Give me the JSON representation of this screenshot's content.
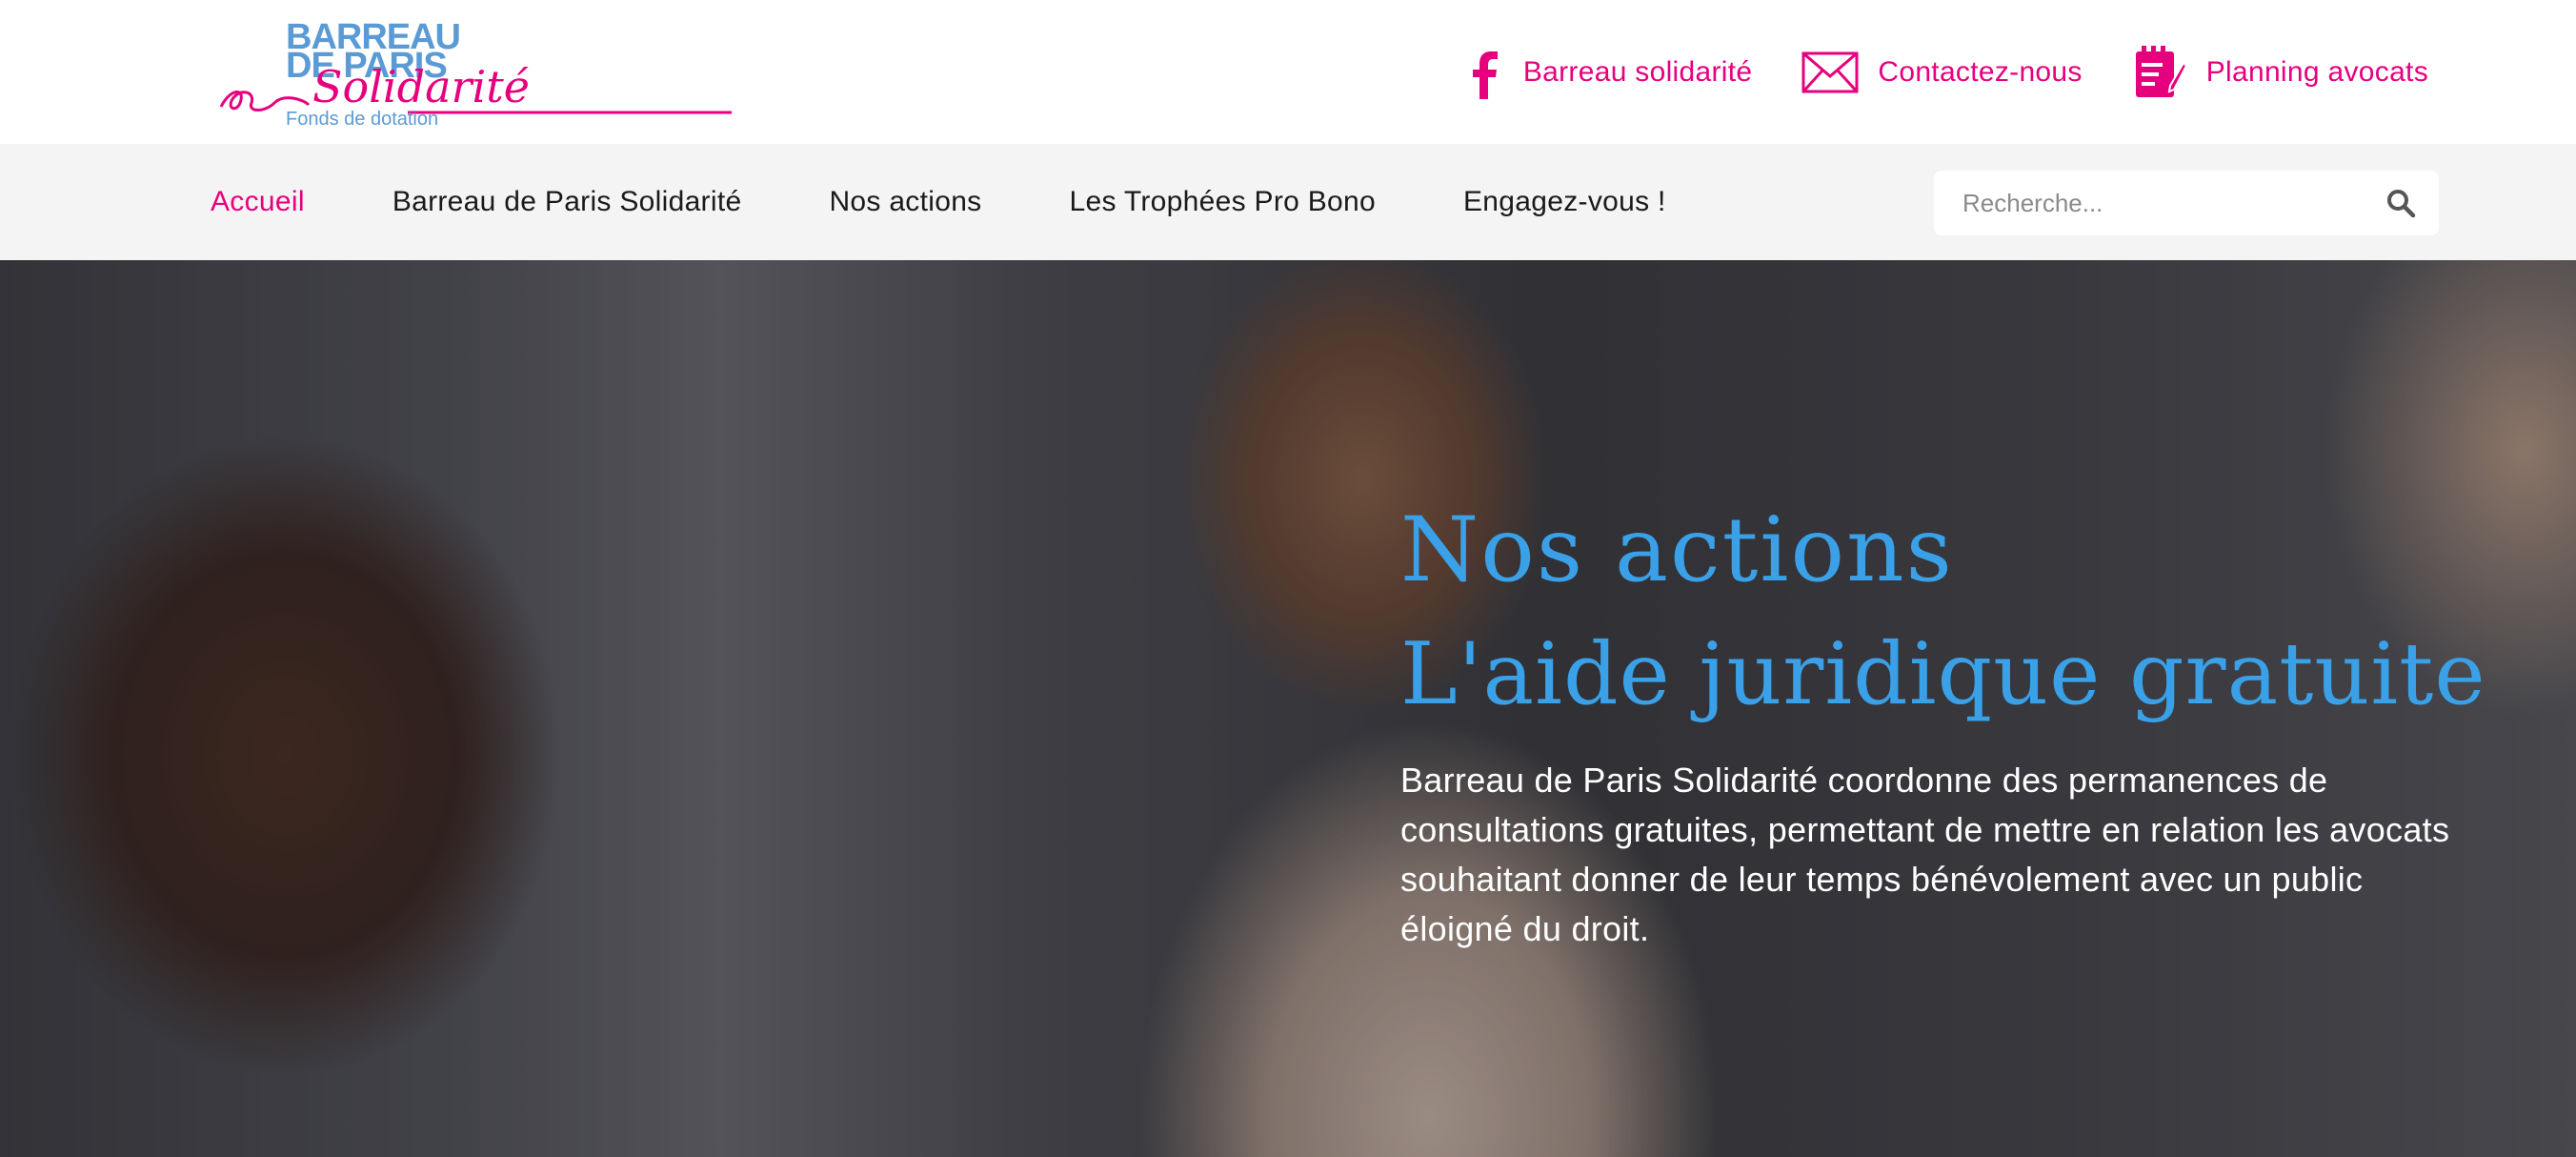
{
  "logo": {
    "line1": "BARREAU",
    "line2": "DE PARIS",
    "script": "Solidarité",
    "subtitle": "Fonds de dotation"
  },
  "top_links": [
    {
      "label": "Barreau solidarité",
      "icon": "facebook-icon"
    },
    {
      "label": "Contactez-nous",
      "icon": "envelope-icon"
    },
    {
      "label": "Planning avocats",
      "icon": "planning-notepad-icon"
    }
  ],
  "nav": {
    "items": [
      {
        "label": "Accueil",
        "active": true
      },
      {
        "label": "Barreau de Paris Solidarité",
        "active": false
      },
      {
        "label": "Nos actions",
        "active": false
      },
      {
        "label": "Les Trophées Pro Bono",
        "active": false
      },
      {
        "label": "Engagez-vous !",
        "active": false
      }
    ]
  },
  "search": {
    "placeholder": "Recherche...",
    "icon": "search-icon"
  },
  "hero": {
    "title_line1": "Nos  actions",
    "title_line2": "L'aide juridique gratuite",
    "description": "Barreau de Paris Solidarité coordonne des permanences de consultations gratuites, permettant de mettre en relation les avocats souhaitant donner de leur temps bénévolement avec un public éloigné du droit."
  },
  "colors": {
    "brand_pink": "#e6007e",
    "brand_blue": "#5b9bd5",
    "hero_title": "#3aa0e8",
    "nav_bg": "#f4f4f4"
  }
}
